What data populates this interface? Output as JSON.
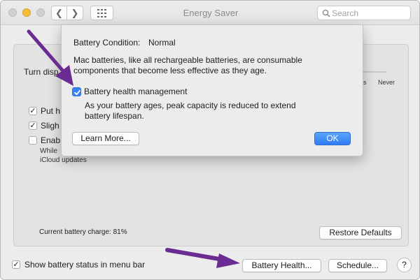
{
  "window": {
    "title": "Energy Saver",
    "search_placeholder": "Search"
  },
  "panel": {
    "turn_display_label": "Turn disp",
    "slider_ticks": [
      "hrs",
      "Never"
    ],
    "options": [
      {
        "label": "Put h",
        "checked": true
      },
      {
        "label": "Sligh",
        "checked": true
      },
      {
        "label": "Enab",
        "checked": false
      }
    ],
    "enable_sub1": "While",
    "enable_sub2": "iCloud updates",
    "battery_charge": "Current battery charge: 81%",
    "restore_label": "Restore Defaults"
  },
  "footer": {
    "show_status_label": "Show battery status in menu bar",
    "show_status_checked": true,
    "battery_health_label": "Battery Health...",
    "schedule_label": "Schedule...",
    "help_label": "?"
  },
  "sheet": {
    "condition_label": "Battery Condition:",
    "condition_value": "Normal",
    "desc_line1": "Mac batteries, like all rechargeable batteries, are consumable",
    "desc_line2": "components that become less effective as they age.",
    "bhm_label": "Battery health management",
    "bhm_checked": true,
    "bhm_desc1": "As your battery ages, peak capacity is reduced to extend",
    "bhm_desc2": "battery lifespan.",
    "learn_more_label": "Learn More...",
    "ok_label": "OK"
  },
  "colors": {
    "accent": "#3a82f7",
    "annotation_arrow": "#6a2c91"
  }
}
